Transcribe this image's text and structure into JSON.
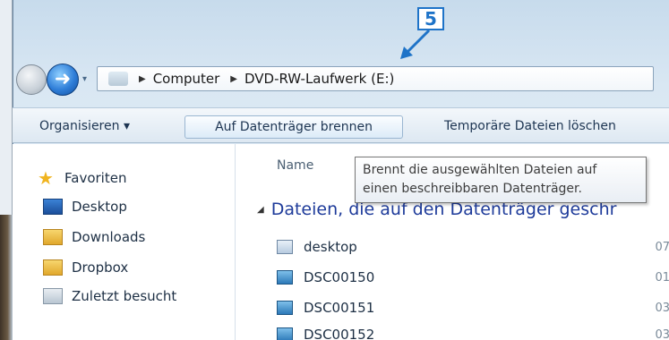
{
  "callout": {
    "number": "5"
  },
  "nav": {
    "back_icon": "back-arrow-icon",
    "forward_icon": "forward-arrow-icon",
    "forward_glyph": "➜",
    "dropdown_glyph": "▾"
  },
  "address": {
    "sep": "▶",
    "items": [
      "Computer",
      "DVD-RW-Laufwerk (E:)"
    ]
  },
  "toolbar": {
    "organize_label": "Organisieren ▾",
    "burn_label": "Auf Datenträger brennen",
    "temp_label": "Temporäre Dateien löschen"
  },
  "sidebar": {
    "favorites_label": "Favoriten",
    "items": [
      "Desktop",
      "Downloads",
      "Dropbox",
      "Zuletzt besucht"
    ]
  },
  "main": {
    "column_name": "Name",
    "group_header": "Dateien, die auf den Datenträger geschr",
    "group_glyph": "◢",
    "files": [
      {
        "name": "desktop",
        "date": "07"
      },
      {
        "name": "DSC00150",
        "date": "01"
      },
      {
        "name": "DSC00151",
        "date": "03"
      },
      {
        "name": "DSC00152",
        "date": "03"
      }
    ]
  },
  "tooltip": {
    "line1": "Brennt die ausgewählten Dateien auf",
    "line2": "einen beschreibbaren Datenträger."
  },
  "colors": {
    "callout": "#1e73c8",
    "group_header": "#1e3b9a"
  }
}
